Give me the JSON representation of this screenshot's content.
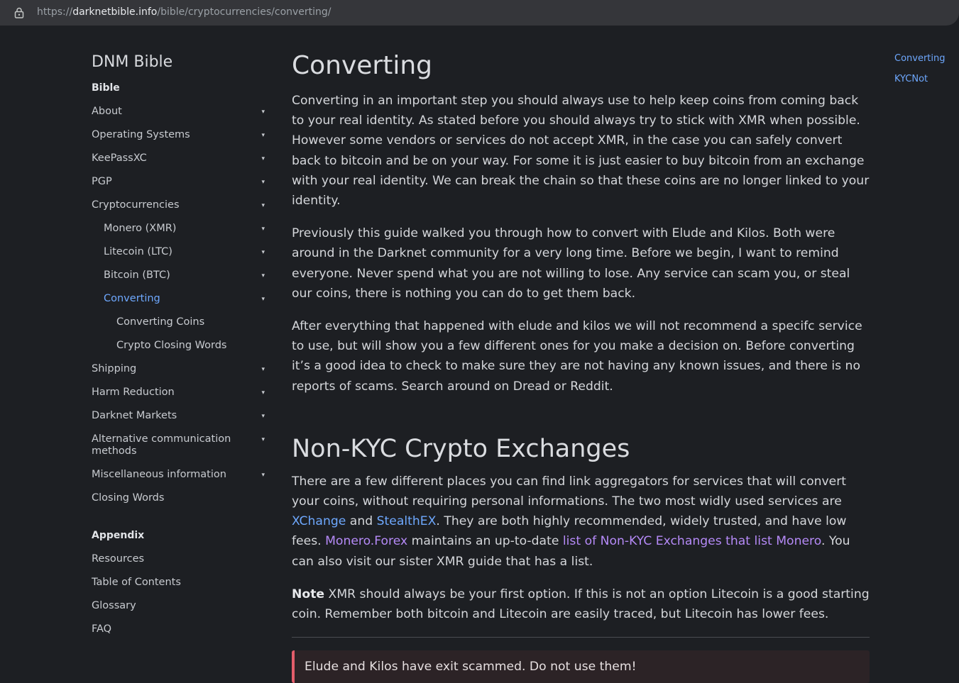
{
  "browser": {
    "url_scheme": "https://",
    "url_host": "darknetbible.info",
    "url_path": "/bible/cryptocurrencies/converting/"
  },
  "sidebar": {
    "site_title": "DNM Bible",
    "section_bible": "Bible",
    "items": [
      {
        "label": "About"
      },
      {
        "label": "Operating Systems"
      },
      {
        "label": "KeePassXC"
      },
      {
        "label": "PGP"
      },
      {
        "label": "Cryptocurrencies"
      },
      {
        "label": "Monero (XMR)"
      },
      {
        "label": "Litecoin (LTC)"
      },
      {
        "label": "Bitcoin (BTC)"
      },
      {
        "label": "Converting"
      },
      {
        "label": "Converting Coins"
      },
      {
        "label": "Crypto Closing Words"
      },
      {
        "label": "Shipping"
      },
      {
        "label": "Harm Reduction"
      },
      {
        "label": "Darknet Markets"
      },
      {
        "label": "Alternative communication methods"
      },
      {
        "label": "Miscellaneous information"
      },
      {
        "label": "Closing Words"
      }
    ],
    "section_appendix": "Appendix",
    "appendix_items": [
      {
        "label": "Resources"
      },
      {
        "label": "Table of Contents"
      },
      {
        "label": "Glossary"
      },
      {
        "label": "FAQ"
      }
    ],
    "caret": "▾"
  },
  "main": {
    "title": "Converting",
    "p1": "Converting in an important step you should always use to help keep coins from coming back to your real identity. As stated before you should always try to stick with XMR when possible. However some vendors or services do not accept XMR, in the case you can safely convert back to bitcoin and be on your way. For some it is just easier to buy bitcoin from an exchange with your real identity. We can break the chain so that these coins are no longer linked to your identity.",
    "p2": "Previously this guide walked you through how to convert with Elude and Kilos. Both were around in the Darknet community for a very long time. Before we begin, I want to remind everyone. Never spend what you are not willing to lose. Any service can scam you, or steal our coins, there is nothing you can do to get them back.",
    "p3": "After everything that happened with elude and kilos we will not recommend a specifc service to use, but will show you a few different ones for you make a decision on. Before converting it’s a good idea to check to make sure they are not having any known issues, and there is no reports of scams. Search around on Dread or Reddit.",
    "h2": "Non-KYC Crypto Exchanges",
    "p4": {
      "t1": "There are a few different places you can find link aggregators for services that will convert your coins, without requiring personal informations. The two most widly used services are ",
      "link_xchange": "XChange",
      "t2": " and ",
      "link_stealthex": "StealthEX",
      "t3": ". They are both highly recommended, widely trusted, and have low fees. ",
      "link_moneroforex": "Monero.Forex",
      "t4": " maintains an up-to-date ",
      "link_list": "list of Non-KYC Exchanges that list Monero",
      "t5": ". You can also visit our sister XMR guide that has a list."
    },
    "note": {
      "label": "Note",
      "text": " XMR should always be your first option. If this is not an option Litecoin is a good starting coin. Remember both bitcoin and Litecoin are easily traced, but Litecoin has lower fees."
    },
    "alert": "Elude and Kilos have exit scammed. Do not use them!"
  },
  "toc": {
    "items": [
      {
        "label": "Converting"
      },
      {
        "label": "KYCNot"
      }
    ]
  },
  "colors": {
    "background": "#1d1f23",
    "link": "#6ea8fe",
    "visited_link": "#b58af7",
    "alert_border": "#e35d6a"
  }
}
